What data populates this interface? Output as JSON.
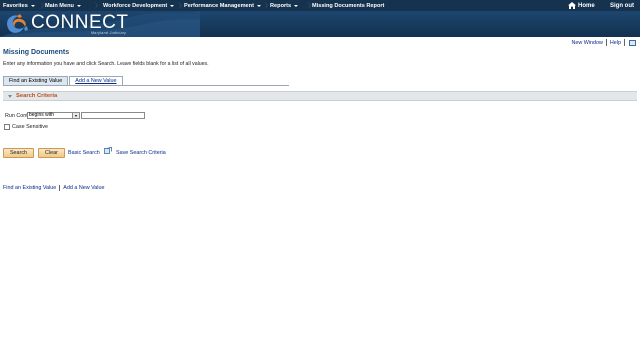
{
  "topnav": {
    "items": [
      {
        "label": "Favorites"
      },
      {
        "label": "Main Menu"
      },
      {
        "label": "Workforce Development"
      },
      {
        "label": "Performance Management"
      },
      {
        "label": "Reports"
      }
    ],
    "current": "Missing Documents Report",
    "home_label": "Home",
    "signout_label": "Sign out",
    "bg_color": "#15324f"
  },
  "banner": {
    "logo_text": "CONNECT",
    "logo_subtext": "Maryland Judiciary",
    "logo_icon": "map-swirl-icon"
  },
  "utility_links": {
    "new_window": "New Window",
    "help": "Help",
    "personalize_icon": "personalize-page-icon"
  },
  "page": {
    "title": "Missing Documents",
    "instructions": "Enter any information you have and click Search. Leave fields blank for a list of all values."
  },
  "tabs": [
    {
      "label": "Find an Existing Value",
      "active": true
    },
    {
      "label": "Add a New Value",
      "active": false
    }
  ],
  "search_criteria": {
    "title": "Search Criteria",
    "run_control_label": "Run Control ID:",
    "operator_selected": "begins with",
    "run_control_value": "",
    "case_sensitive_label": "Case Sensitive",
    "case_sensitive_checked": false
  },
  "actions": {
    "search_label": "Search",
    "clear_label": "Clear",
    "basic_search_label": "Basic Search",
    "save_search_label": "Save Search Criteria",
    "button_color": "#f1c888"
  },
  "bottom_links": {
    "find_existing": "Find an Existing Value",
    "add_new": "Add a New Value"
  },
  "colors": {
    "link": "#0b2b8a",
    "title": "#1d4a7a",
    "section_title": "#b5531f"
  }
}
